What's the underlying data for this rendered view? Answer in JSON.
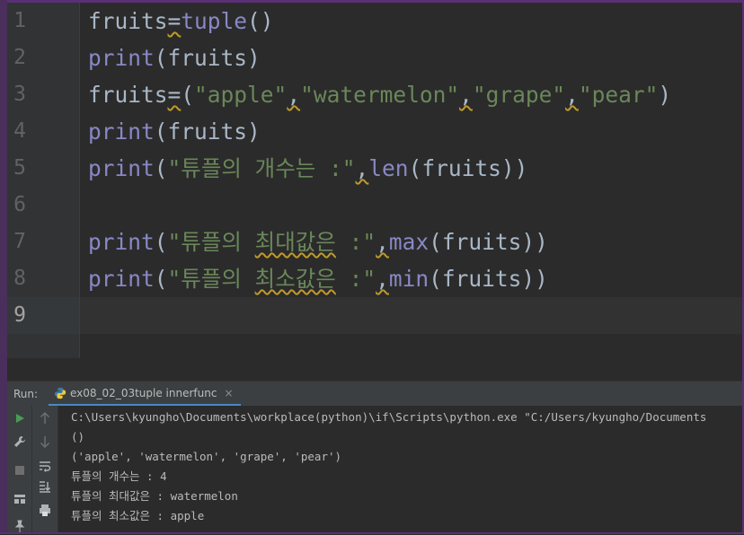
{
  "editor": {
    "lines": [
      {
        "n": "1",
        "tokens": [
          {
            "t": "fruits"
          },
          {
            "t": "=",
            "wavy": true
          },
          {
            "t": "tuple",
            "c": "kw"
          },
          {
            "t": "()"
          }
        ]
      },
      {
        "n": "2",
        "tokens": [
          {
            "t": "print",
            "c": "kw"
          },
          {
            "t": "(fruits)"
          }
        ]
      },
      {
        "n": "3",
        "tokens": [
          {
            "t": "fruits"
          },
          {
            "t": "=",
            "wavy": true
          },
          {
            "t": "("
          },
          {
            "t": "\"apple\"",
            "c": "str"
          },
          {
            "t": ",",
            "wavy": true
          },
          {
            "t": "\"watermelon\"",
            "c": "str"
          },
          {
            "t": ",",
            "wavy": true
          },
          {
            "t": "\"grape\"",
            "c": "str"
          },
          {
            "t": ",",
            "wavy": true
          },
          {
            "t": "\"pear\"",
            "c": "str"
          },
          {
            "t": ")"
          }
        ]
      },
      {
        "n": "4",
        "tokens": [
          {
            "t": "print",
            "c": "kw"
          },
          {
            "t": "(fruits)"
          }
        ]
      },
      {
        "n": "5",
        "tokens": [
          {
            "t": "print",
            "c": "kw"
          },
          {
            "t": "("
          },
          {
            "t": "\"튜플의 개수는 :\"",
            "c": "str"
          },
          {
            "t": ",",
            "wavy": true
          },
          {
            "t": "len",
            "c": "kw"
          },
          {
            "t": "(fruits))"
          }
        ]
      },
      {
        "n": "6",
        "tokens": []
      },
      {
        "n": "7",
        "tokens": [
          {
            "t": "print",
            "c": "kw"
          },
          {
            "t": "("
          },
          {
            "t": "\"튜플의 ",
            "c": "str"
          },
          {
            "t": "최대값은",
            "c": "str",
            "wavy": true
          },
          {
            "t": " :\"",
            "c": "str"
          },
          {
            "t": ",",
            "wavy": true
          },
          {
            "t": "max",
            "c": "kw"
          },
          {
            "t": "(fruits))"
          }
        ]
      },
      {
        "n": "8",
        "tokens": [
          {
            "t": "print",
            "c": "kw"
          },
          {
            "t": "("
          },
          {
            "t": "\"튜플의 ",
            "c": "str"
          },
          {
            "t": "최소값은",
            "c": "str",
            "wavy": true
          },
          {
            "t": " :\"",
            "c": "str"
          },
          {
            "t": ",",
            "wavy": true
          },
          {
            "t": "min",
            "c": "kw"
          },
          {
            "t": "(fruits))"
          }
        ]
      },
      {
        "n": "9",
        "tokens": [],
        "active": true
      }
    ]
  },
  "run_panel": {
    "title": "Run:",
    "tab_label": "ex08_02_03tuple innerfunc",
    "tab_close": "×",
    "output": [
      "C:\\Users\\kyungho\\Documents\\workplace(python)\\if\\Scripts\\python.exe \"C:/Users/kyungho/Documents",
      "()",
      "('apple', 'watermelon', 'grape', 'pear')",
      "튜플의 개수는 : 4",
      "튜플의 최대값은 : watermelon",
      "튜플의 최소값은 : apple"
    ]
  },
  "colors": {
    "keyword": "#8888c6",
    "string": "#6a8759",
    "text": "#a9b7c6",
    "warning_underline": "#c09a2b",
    "run_green": "#499c54"
  },
  "icons": [
    "python-file-icon",
    "run-icon",
    "wrench-icon",
    "stop-icon",
    "layout-icon",
    "pin-icon",
    "up-arrow-icon",
    "down-arrow-icon",
    "soft-wrap-icon",
    "scroll-to-end-icon",
    "print-icon"
  ]
}
